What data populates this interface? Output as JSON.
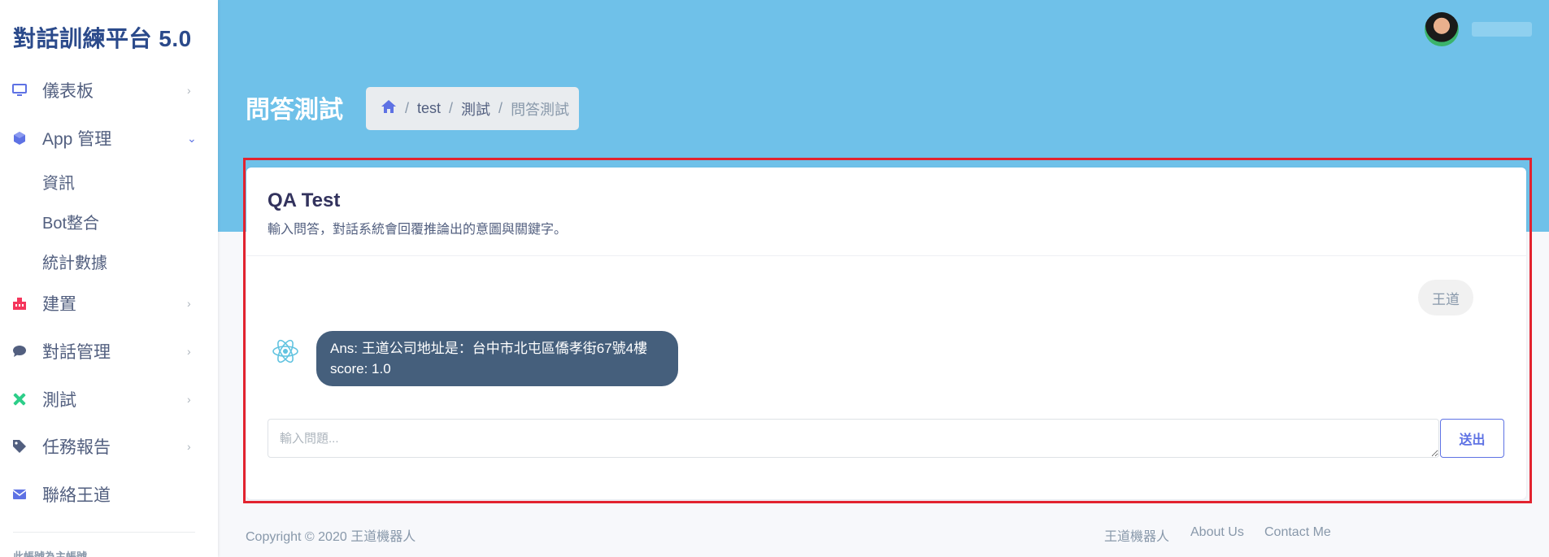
{
  "brand": "對話訓練平台 5.0",
  "sidebar": {
    "items": [
      {
        "label": "儀表板",
        "icon": "monitor-icon"
      },
      {
        "label": "App 管理",
        "icon": "cube-icon"
      },
      {
        "label": "建置",
        "icon": "building-icon"
      },
      {
        "label": "對話管理",
        "icon": "chat-bubble-icon"
      },
      {
        "label": "測試",
        "icon": "tools-icon"
      },
      {
        "label": "任務報告",
        "icon": "tag-icon"
      },
      {
        "label": "聯絡王道",
        "icon": "envelope-icon"
      }
    ],
    "sub_items": [
      "資訊",
      "Bot整合",
      "統計數據"
    ],
    "footer_text": "此帳號為主帳號"
  },
  "header": {
    "page_title": "問答測試",
    "breadcrumb": [
      "test",
      "測試",
      "問答測試"
    ]
  },
  "card": {
    "title": "QA Test",
    "subtitle": "輸入問答，對話系統會回覆推論出的意圖與關鍵字。"
  },
  "chat": {
    "user_message": "王道",
    "bot_line1": "Ans: 王道公司地址是：台中市北屯區僑孝街67號4樓",
    "bot_line2": "score: 1.0"
  },
  "input": {
    "placeholder": "輸入問題...",
    "send_label": "送出"
  },
  "footer": {
    "copyright": "Copyright © 2020 王道機器人",
    "links": [
      "王道機器人",
      "About Us",
      "Contact Me"
    ]
  },
  "colors": {
    "header_bg": "#6fc1e9",
    "brand_text": "#2b4a8b",
    "bot_bubble": "#455f7c",
    "highlight_border": "#e2232f",
    "primary": "#5e72e4"
  }
}
